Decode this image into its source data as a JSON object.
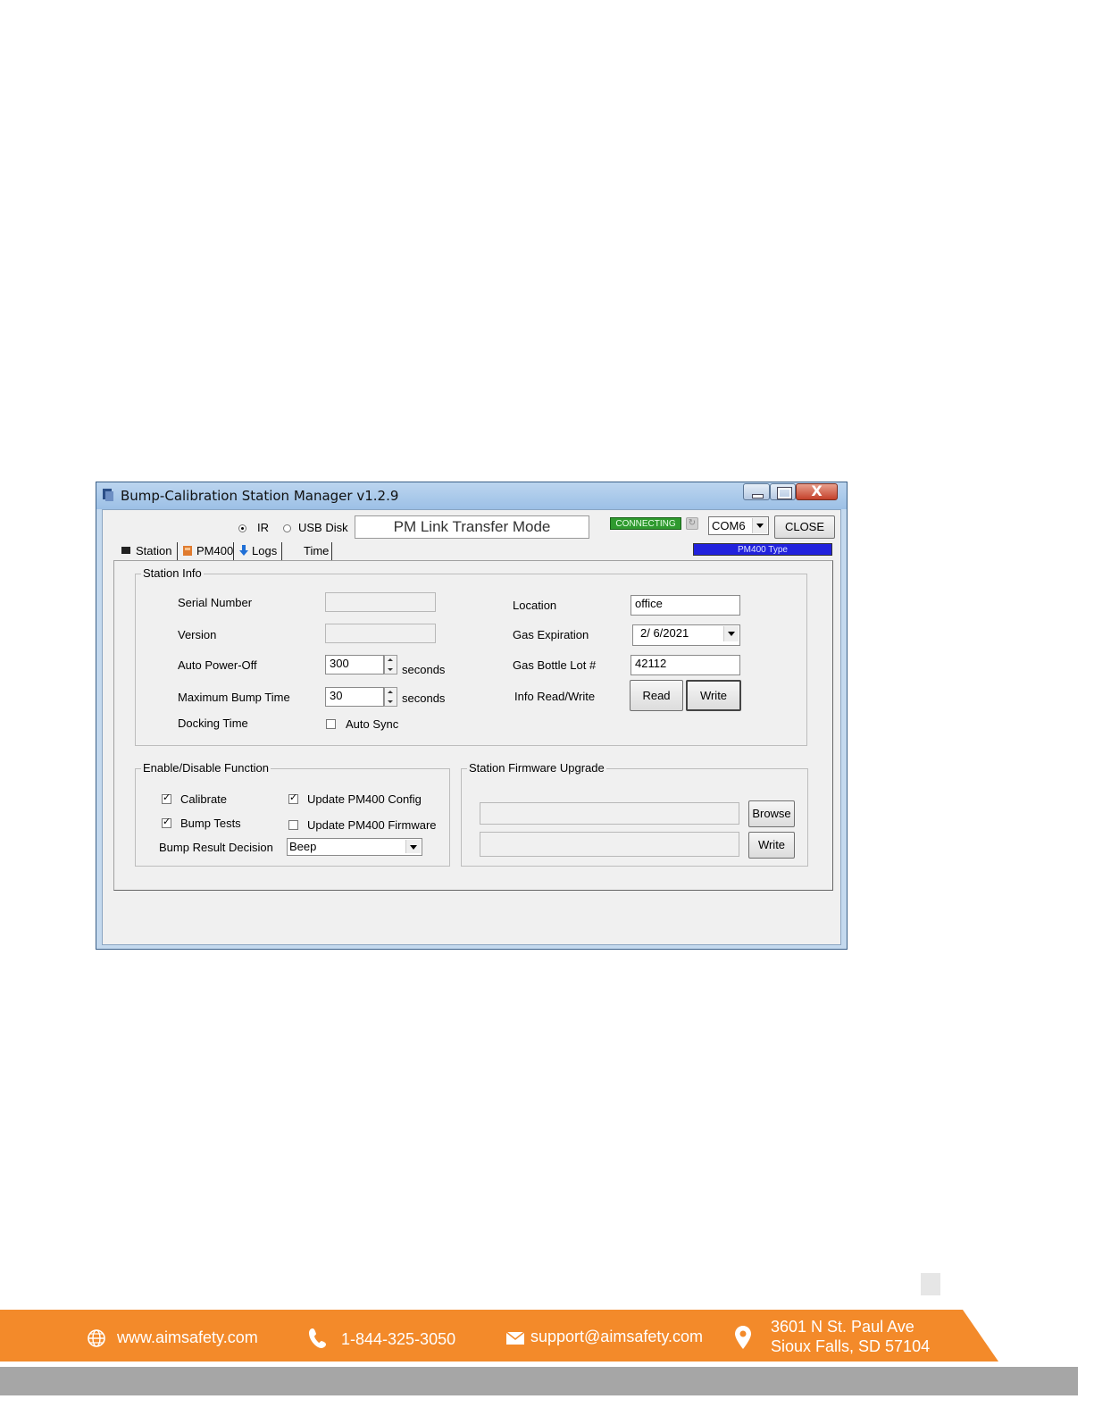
{
  "window": {
    "title": "Bump-Calibration Station Manager v1.2.9",
    "controls": {
      "close_glyph": "X"
    }
  },
  "toolbar": {
    "radio_ir": "IR",
    "radio_usb": "USB Disk",
    "mode_text": "PM Link Transfer Mode",
    "status": "CONNECTING",
    "com_port": "COM6",
    "close_label": "CLOSE",
    "device_type": "PM400 Type"
  },
  "tabs": [
    {
      "label": "Station"
    },
    {
      "label": "PM400"
    },
    {
      "label": "Logs"
    },
    {
      "label": "Time"
    }
  ],
  "station_info": {
    "title": "Station Info",
    "serial_label": "Serial Number",
    "serial_value": "",
    "version_label": "Version",
    "version_value": "",
    "auto_power_label": "Auto Power-Off",
    "auto_power_value": "300",
    "auto_power_unit": "seconds",
    "max_bump_label": "Maximum Bump Time",
    "max_bump_value": "30",
    "max_bump_unit": "seconds",
    "docking_label": "Docking Time",
    "auto_sync_label": "Auto Sync",
    "location_label": "Location",
    "location_value": "office",
    "gas_exp_label": "Gas Expiration",
    "gas_exp_value": "2/ 6/2021",
    "gas_lot_label": "Gas Bottle Lot #",
    "gas_lot_value": "42112",
    "info_rw_label": "Info Read/Write",
    "read_label": "Read",
    "write_label": "Write"
  },
  "functions": {
    "title": "Enable/Disable Function",
    "calibrate_label": "Calibrate",
    "bump_tests_label": "Bump Tests",
    "update_config_label": "Update PM400 Config",
    "update_firmware_label": "Update PM400 Firmware",
    "bump_result_label": "Bump Result Decision",
    "bump_result_value": "Beep"
  },
  "firmware": {
    "title": "Station Firmware Upgrade",
    "browse_label": "Browse",
    "write_label": "Write"
  },
  "footer": {
    "website": "www.aimsafety.com",
    "phone": "1-844-325-3050",
    "email": "support@aimsafety.com",
    "address_line1": "3601 N St. Paul Ave",
    "address_line2": "Sioux Falls, SD 57104",
    "colors": {
      "band": "#f38a2a",
      "bar": "#a6a6a6"
    }
  }
}
